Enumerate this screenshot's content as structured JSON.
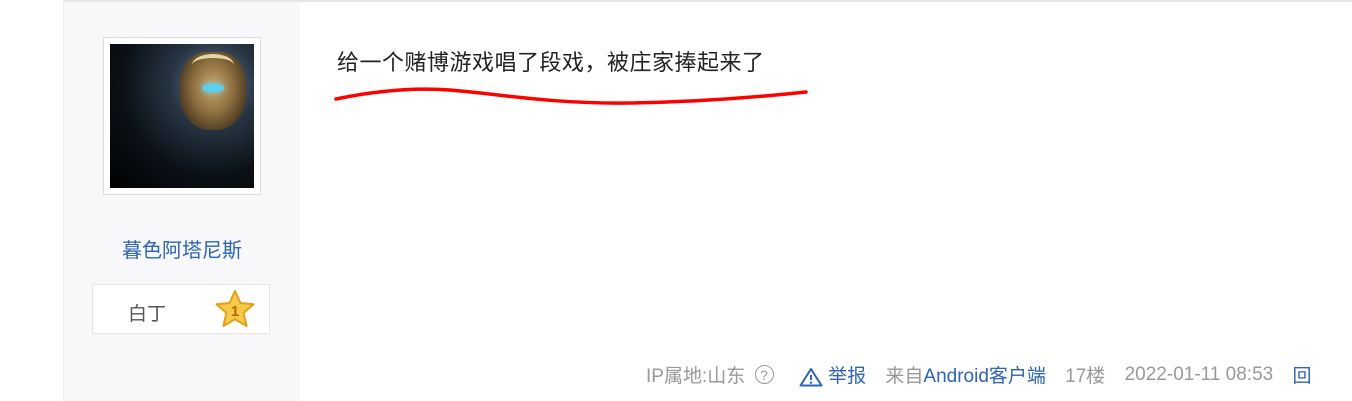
{
  "post": {
    "title": "给一个赌博游戏唱了段戏，被庄家捧起来了"
  },
  "author": {
    "name": "暮色阿塔尼斯",
    "rank_label": "白丁",
    "level": "1"
  },
  "meta": {
    "ip_location": "IP属地:山东",
    "help_icon": "?",
    "report_label": "举报",
    "source_prefix": "来自",
    "source_client": "Android客户端",
    "floor": "17楼",
    "datetime": "2022-01-11 08:53",
    "reply_label": "回"
  },
  "colors": {
    "link": "#2d64b3",
    "annotation": "#ff0000",
    "sidebar_bg": "#f8f8fb"
  },
  "icons": {
    "level_badge": "star-icon",
    "report": "warning-triangle-icon",
    "help": "question-circle-icon"
  }
}
